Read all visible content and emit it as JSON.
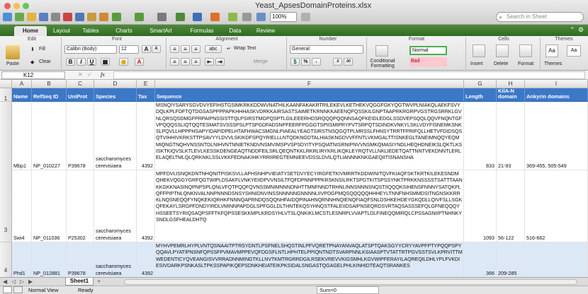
{
  "window": {
    "title": "Yeast_ApsesDomainProteins.xlsx",
    "zoom": "100%",
    "search_placeholder": "Search in Sheet"
  },
  "tabs": [
    "Home",
    "Layout",
    "Tables",
    "Charts",
    "SmartArt",
    "Formulas",
    "Data",
    "Review"
  ],
  "ribbon": {
    "groups": {
      "edit": "Edit",
      "font": "Font",
      "alignment": "Alignment",
      "number": "Number",
      "format": "Format",
      "cells": "Cells",
      "themes": "Themes"
    },
    "paste": "Paste",
    "fill": "Fill",
    "clear": "Clear",
    "font_name": "Calibri (Body)",
    "font_size": "12",
    "abc": "abc",
    "wrap_text": "Wrap Text",
    "merge": "Merge",
    "number_format": "General",
    "conditional_formatting": "Conditional Formatting",
    "style_normal": "Normal",
    "style_bad": "Bad",
    "insert": "Insert",
    "delete": "Delete",
    "format_btn": "Format",
    "themes_btn": "Themes",
    "bold": "B",
    "italic": "I",
    "underline": "U",
    "font_color_letter": "A"
  },
  "formula_bar": {
    "name_box": "K12",
    "fx": "fx"
  },
  "columns": [
    "A",
    "B",
    "C",
    "D",
    "E",
    "F",
    "G",
    "H",
    "I"
  ],
  "headers": {
    "name": "Name",
    "refseq": "RefSeq ID",
    "uniprot": "UniProt",
    "species": "Species",
    "tax": "Tax",
    "sequence": "Sequence",
    "length": "Length",
    "kila": "KilA-N domain",
    "ankyrin": "Ankyrin domains"
  },
  "rows": [
    {
      "row": "2",
      "name": "Mbp1",
      "refseq": "NP_010227",
      "uniprot": "P39678",
      "species": "saccharomyces cerevisiaea",
      "tax": "4392",
      "sequence": "MSNQIYSARYSGVDVYEFIHSTGSIMKRKKDDWVNATHILKAANFAKAKRTRILEKEVLKETHEKVQGGFGKYQGTWVPLNIAKQLAEKFSVYDQLKPLFDFTQTDGSASPPPPAPKHHHASKVDRKKAIRSASTSAIMETKRNNKKAEENQFQSSKILGNPTAAPRKRGRPVGSTRGSRRKLGVNLQRSQSDMGFPRPAIPNSSISTTQLPSIRSTMGPQSPTLGILEEERHDSRQQQPQQNNSAQFKEIDLEDGLSSDVEPSQQLQQVFNQNTGFVPQQQSSLIQTQQTESMATSVSSSPSLPTSPGDFADSNPFEERFPGGGTSPIISMIPRYPVTSRPQTSDINDKVNKYLSKLVDYFISNEMKSNKSLPQVLLHPPPHSAPYIDAPIDPELHTAFHWACSMGNLPIAEALYEAGTSIRSTNSQGQTPLMRSSLFHNSYTRRTFPRIFQLLHETVFDIDSQSQTVIHHIVKRKSTTPSAVYYLDVVLSKIKDFSPQYRIELLLNTQDKNGDTALHIASKNGDVVFFNTLVKMGALTTISNKEGLTANEIMNQQYEQMMIQNGTNQHVNSSNTDLNIHVNTNNIETKNDVNSMVIMSPVSPSDYITYPSQIATNISRNIPNVVNSMKQMASIYNDLHEQHDNEIKSLQKTLKSISKTKIQVSLKTLEVLKESSKDENGEAQTNDDFEILSRLQEQNTKKLRKRLIRYKRLIKQKLEYRQTVLLNKLIEDETQATTNNTVEKDNNTLERLELAQELTMLQLQRKNKLSSLVKKFEDNAKIHKYRRIIREGTEMNIEEVDSSLDVILQTLIANNNKNKGAEQIITISNANSHA",
      "length": "833",
      "kila": "21-93",
      "ankyrin": "369-455, 505-549"
    },
    {
      "row": "3",
      "name": "Swi4",
      "refseq": "NP_011036",
      "uniprot": "P25302",
      "species": "saccharomyces cerevisiaea",
      "tax": "4392",
      "sequence": "MPFDVLISNQKDNTNHQNITPISKSVLLAPHSNHPVIEIATYSETDVYECYIRGFETKIVMRRTKDDWINITQVFKIAQFSKTKRTKILEKESNDMQHEKVQGGYGRFQGTWIPLDSAKFLVNKYEIIDPVVNSILTFQFDPNNPPPKRSKNSILRKTSPGTKITSPSSYNKTPRKKNSSSSTSATTTAANKKGKKNASINQPNPSPLQNLVFQTPQQFQVNSSMNIMNNNDNHTTMNFNNDTRHNLINNSNNNSNQSTIIQQQKSIHENSFNNNYSATQKPLQFFPIPTNLQNKNVALNNPNNNDSNSYSHNIDNVINSSNNNNNGNNNNLIIVPDGPMQSQQQQQHHHEYLTNNFNHSMMDSITNGNSKKRRKLNQSNEQQFYNQKEKIQRHKFNNNQAPRNDQSQQNHFAIDQPINAHNQRNNHNQIENQFIAQFSNLDSHKEHDEYGKQDLLQIVFSLLSGKQFEKAYLSRGPFDNDYIRDLVMINNPAPDGLSPFGGLDLTHNTEKQSYHNQSTFALEIIDSAIPNSEQRDSVRTAQSASSSEFQLGFNEQQQYHSSEETSYRIQSAQPSFFTKFQPSSESKKMPLKRDSYHLVTSLQNKIKLMCSTLESNRPLVVAPTLDLFINEQQMIRQLCPSSAGNIIPTNHNKYSNDLGSFHEALDHTQ",
      "length": "1093",
      "kila": "56-122",
      "ankyrin": "516-662"
    },
    {
      "row": "4",
      "name": "Phd1",
      "refseq": "NP_012881",
      "uniprot": "P39678",
      "species": "saccharomyces cerevisiaea",
      "tax": "4392",
      "sequence": "MYHVPEMRLHYPLVNTQSNAAITPTRSYDNTLPSFNELSHQSTINLPFVQRETPNAYANVAQLATSPTQAKSGYYCRYYAVPFPTYPQQPSPYQQAVLPYATIPNSNFQPSSFPVMAVMPPEVQFDGSFLNTLHPHTELPPIQNTNDTSVARPNNLKSIAASPTVTATTRTPGVSSTSVLKPRVITTMWEDENTICYQVEANGISVVRRADNNMINGTKLLNVTKMTRGRRDGILRSEKVREVVKIGSMHLKGVWIPFERAYILAQREQILDHLYPLFVKDIESIVDARKPSNKASLTPKSSPAPIKQEPSDNKHEIATEIKPKSIDALSNGASTQGAGELPHLKINHIDTEAQTSRANKES",
      "length": "366",
      "kila": "209-285",
      "ankyrin": ""
    }
  ],
  "sheet": {
    "tab": "Sheet1",
    "add": "+"
  },
  "status": {
    "view": "Normal View",
    "ready": "Ready",
    "sum": "Sum=0"
  }
}
